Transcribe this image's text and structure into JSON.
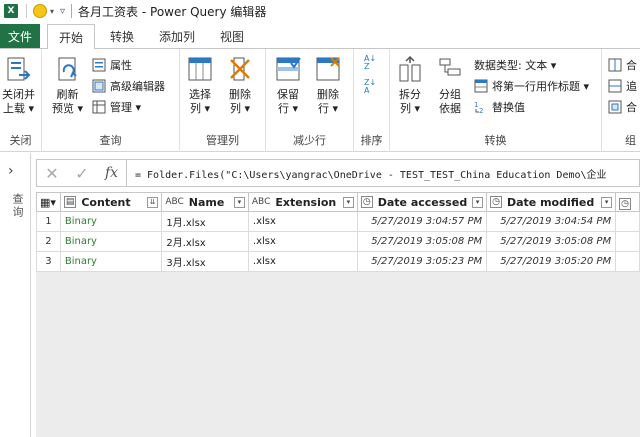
{
  "app": {
    "excel_badge": "X",
    "window_title": "各月工资表 - Power Query 编辑器"
  },
  "tabs": {
    "file": "文件",
    "items": [
      "开始",
      "转换",
      "添加列",
      "视图"
    ]
  },
  "ribbon": {
    "close_group": {
      "close_apply": "关闭并",
      "close_apply2": "上载 ▾",
      "label": "关闭"
    },
    "query_group": {
      "refresh": "刷新",
      "refresh2": "预览 ▾",
      "properties": "属性",
      "advanced_editor": "高级编辑器",
      "manage": "管理 ▾",
      "label": "查询"
    },
    "manage_columns_group": {
      "choose": "选择",
      "choose2": "列 ▾",
      "remove": "删除",
      "remove2": "列 ▾",
      "label": "管理列"
    },
    "reduce_rows_group": {
      "keep": "保留",
      "keep2": "行 ▾",
      "remove": "删除",
      "remove2": "行 ▾",
      "label": "减少行"
    },
    "sort_group": {
      "label": "排序"
    },
    "transform_group": {
      "split": "拆分",
      "split2": "列 ▾",
      "group": "分组",
      "group2": "依据",
      "data_type": "数据类型: 文本 ▾",
      "first_row_header": "将第一行用作标题 ▾",
      "replace_values": "替换值",
      "label": "转换"
    },
    "combine_group": {
      "merge": "合",
      "append": "追",
      "combine": "合",
      "label": "组"
    }
  },
  "left_pane": {
    "chevron": "›",
    "label": "查询"
  },
  "formula_bar": {
    "cancel": "✕",
    "confirm": "✓",
    "fx": "fx",
    "formula": "= Folder.Files(\"C:\\Users\\yangrac\\OneDrive - TEST_TEST_China Education Demo\\企业"
  },
  "table": {
    "columns": [
      "Content",
      "Name",
      "Extension",
      "Date accessed",
      "Date modified",
      ""
    ],
    "rows": [
      {
        "num": "1",
        "content": "Binary",
        "name": "1月.xlsx",
        "ext": ".xlsx",
        "accessed": "5/27/2019 3:04:57 PM",
        "modified": "5/27/2019 3:04:54 PM"
      },
      {
        "num": "2",
        "content": "Binary",
        "name": "2月.xlsx",
        "ext": ".xlsx",
        "accessed": "5/27/2019 3:05:08 PM",
        "modified": "5/27/2019 3:05:08 PM"
      },
      {
        "num": "3",
        "content": "Binary",
        "name": "3月.xlsx",
        "ext": ".xlsx",
        "accessed": "5/27/2019 3:05:23 PM",
        "modified": "5/27/2019 3:05:20 PM"
      }
    ]
  },
  "colors": {
    "excel_green": "#217346",
    "binary_green": "#2e7d32"
  }
}
